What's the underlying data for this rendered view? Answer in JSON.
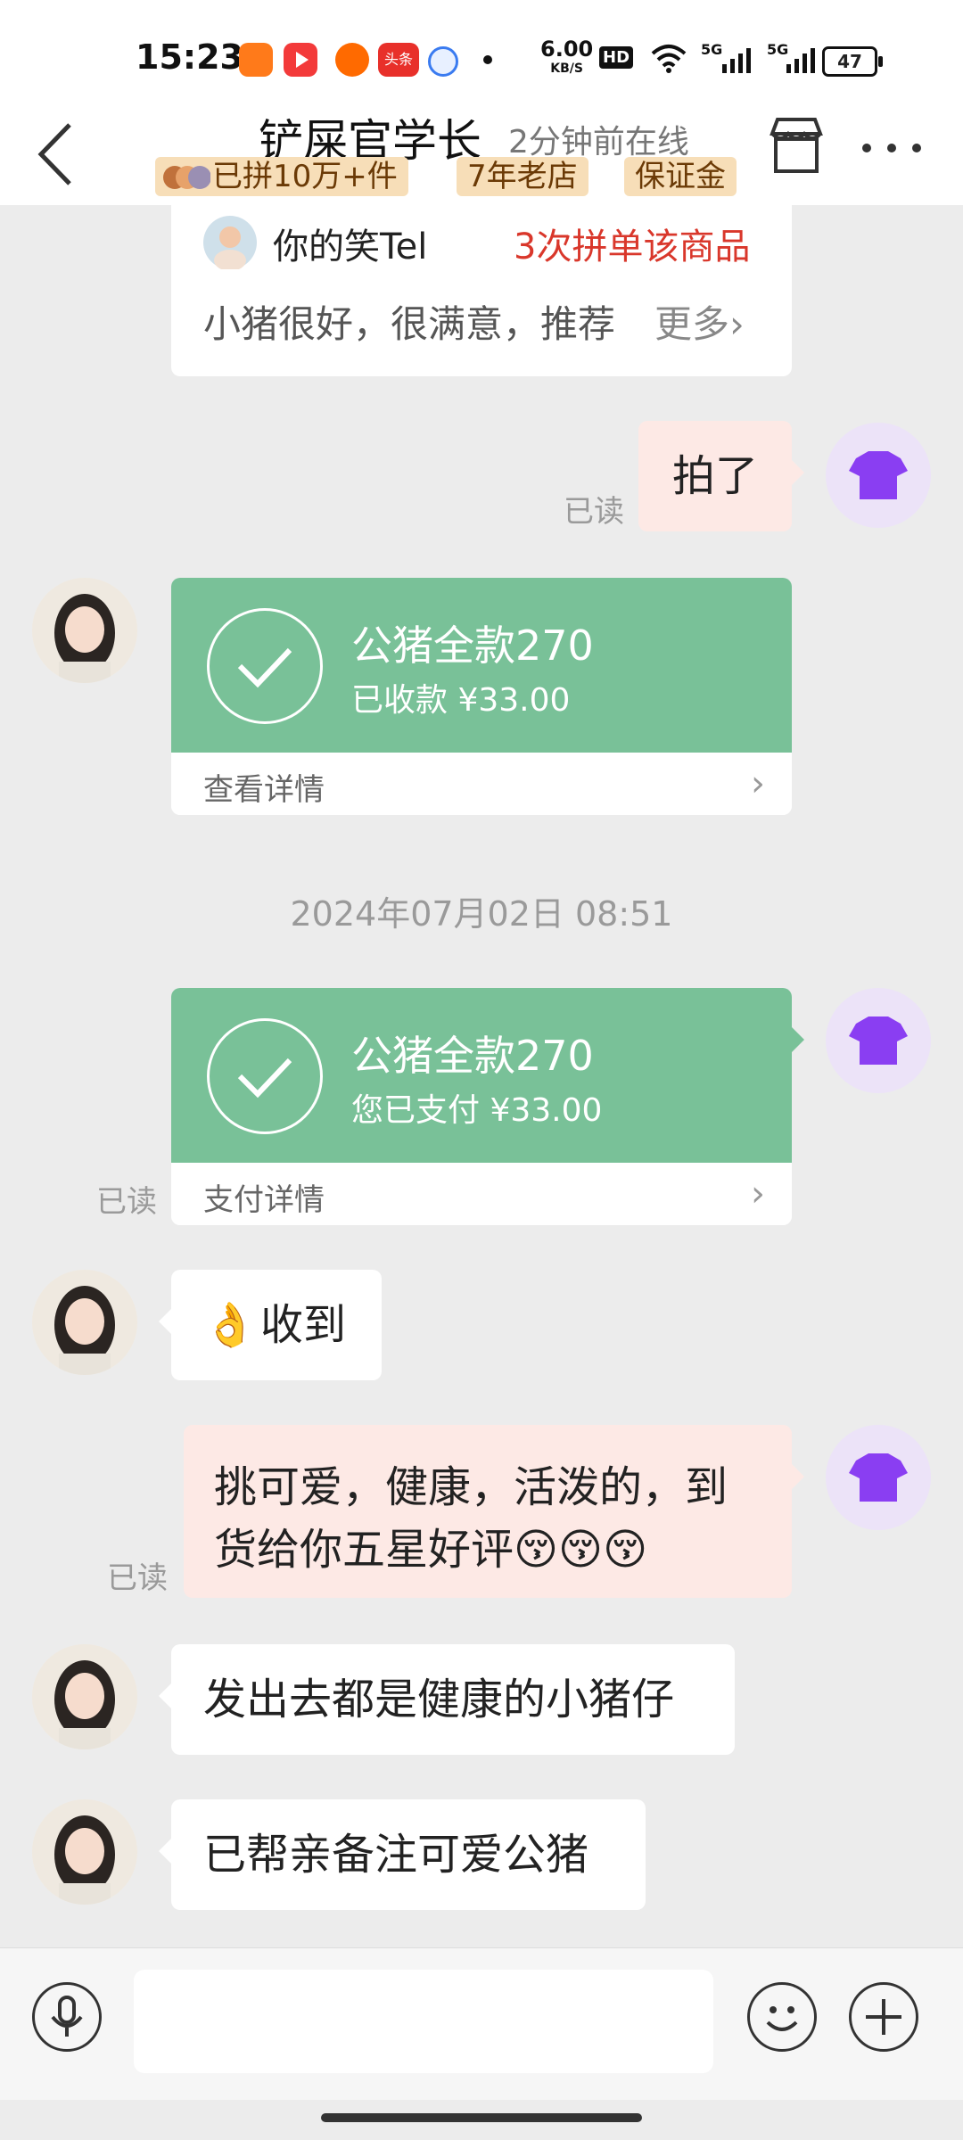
{
  "status_bar": {
    "time": "15:23",
    "net_speed_value": "6.00",
    "net_speed_unit": "KB/S",
    "hd": "HD",
    "signal_1": "5G",
    "signal_2": "5G",
    "battery": "47",
    "app_badge_toutiao": "头条"
  },
  "header": {
    "shop_name": "铲屎官学长",
    "online_status": "2分钟前在线",
    "badges": [
      "已拼10万+件",
      "7年老店",
      "保证金"
    ]
  },
  "review_card": {
    "reviewer": "你的笑Tel",
    "purchase_count": "3次拼单该商品",
    "text": "小猪很好，很满意，推荐",
    "more": "更多"
  },
  "messages": {
    "m1": {
      "text": "拍了",
      "read": "已读"
    },
    "payment_received": {
      "title": "公猪全款270",
      "subtitle": "已收款 ¥33.00",
      "link": "查看详情"
    },
    "timestamp": "2024年07月02日 08:51",
    "payment_sent": {
      "title": "公猪全款270",
      "subtitle": "您已支付 ¥33.00",
      "link": "支付详情",
      "read": "已读"
    },
    "m2": {
      "emoji": "👌",
      "text": "收到"
    },
    "m3": {
      "text_line1": "挑可爱，健康，活泼的，到",
      "text_line2": "货给你五星好评",
      "emojis": "😚😚😚",
      "read": "已读"
    },
    "m4": {
      "text": "发出去都是健康的小猪仔"
    },
    "m5": {
      "text": "已帮亲备注可爱公猪"
    }
  },
  "input": {
    "placeholder": ""
  },
  "colors": {
    "pay_green": "#79c198",
    "my_bubble": "#fde9e5",
    "badge_bg": "#f7deb8",
    "accent_red": "#d9372b"
  }
}
